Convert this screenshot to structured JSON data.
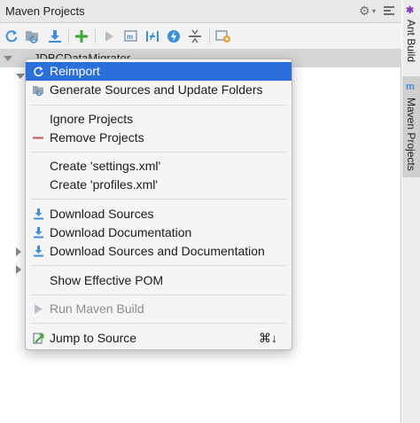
{
  "window": {
    "title": "Maven Projects",
    "gear_icon": "gear-icon",
    "tree_root": "JDBCDataMigrator"
  },
  "right_stripe": {
    "ant_build": "Ant Build",
    "maven_projects": "Maven Projects"
  },
  "toolbar": {
    "icons": [
      "reimport-icon",
      "generate-sources-icon",
      "download-icon",
      "add-icon",
      "run-icon",
      "execute-goal-icon",
      "toggle-offline-icon",
      "skip-tests-icon",
      "collapse-all-icon",
      "settings-icon"
    ]
  },
  "menu": {
    "reimport": "Reimport",
    "generate_sources": "Generate Sources and Update Folders",
    "ignore_projects": "Ignore Projects",
    "remove_projects": "Remove Projects",
    "create_settings": "Create 'settings.xml'",
    "create_profiles": "Create 'profiles.xml'",
    "download_sources": "Download Sources",
    "download_documentation": "Download Documentation",
    "download_both": "Download Sources and Documentation",
    "show_effective_pom": "Show Effective POM",
    "run_maven_build": "Run Maven Build",
    "jump_to_source": "Jump to Source",
    "jump_to_source_shortcut": "⌘↓"
  },
  "colors": {
    "selection": "#2b6fdb",
    "accent_blue": "#3d8fd8",
    "add_green": "#3aa935",
    "remove_red": "#c75450"
  }
}
